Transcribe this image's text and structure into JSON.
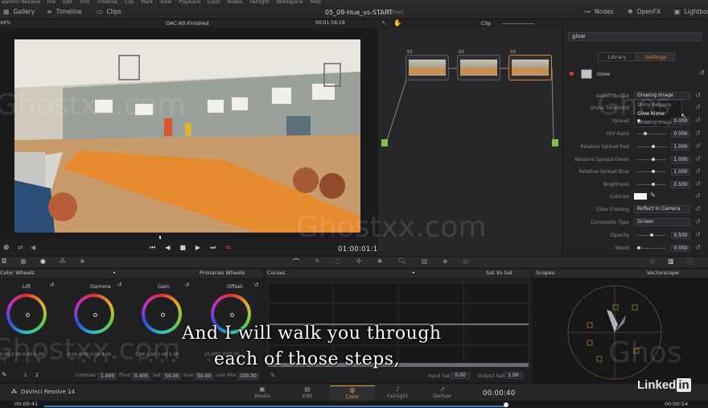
{
  "menu": [
    "DaVinci Resolve",
    "File",
    "Edit",
    "Trim",
    "Timeline",
    "Clip",
    "Mark",
    "View",
    "Playback",
    "Color",
    "Nodes",
    "Fairlight",
    "Workspace",
    "Help"
  ],
  "toolbar": {
    "gallery": "Gallery",
    "timeline": "Timeline",
    "clips": "Clips",
    "project_title": "05_09-Hue_vs-START",
    "edited": "Edited",
    "nodes": "Nodes",
    "openfx": "OpenFX",
    "lightbox": "Lightbox"
  },
  "viewer": {
    "zoom": "48%",
    "clip_name": "OAC-60-Finished",
    "timecode_top": "00:01:59:19",
    "timecode": "01:00:01:12"
  },
  "node_editor": {
    "mode": "Clip",
    "nodes": [
      "01",
      "02",
      "03"
    ]
  },
  "fx": {
    "search": "glow",
    "tab_library": "Library",
    "tab_settings": "Settings",
    "effect_name": "Glow",
    "select_output_label": "Select Output",
    "select_output_value": "Glowing Image",
    "dropdown_options": [
      "Shiny Regions",
      "Glow Alone",
      "Glowing Image"
    ],
    "shine_threshold_label": "Shine Threshold",
    "params": [
      {
        "label": "Spread",
        "value": "0.000"
      },
      {
        "label": "H/V Ratio",
        "value": "0.000"
      },
      {
        "label": "Relative Spread Red",
        "value": "1.000"
      },
      {
        "label": "Relative Spread Green",
        "value": "1.000"
      },
      {
        "label": "Relative Spread Blue",
        "value": "1.000"
      },
      {
        "label": "Brightness",
        "value": "0.500"
      }
    ],
    "colorize_label": "Colorize",
    "glow_framing_label": "Glow Framing",
    "glow_framing_value": "Reflect In Camera",
    "composite_label": "Composite Type",
    "composite_value": "Screen",
    "opacity_label": "Opacity",
    "opacity_value": "0.500",
    "blend_label": "Blend",
    "blend_value": "0.000"
  },
  "color_wheels": {
    "header": "Color Wheels",
    "mode": "Primaries Wheels",
    "wheels": [
      "Lift",
      "Gamma",
      "Gain",
      "Offset"
    ],
    "lift_vals": [
      "0.00",
      "0.00",
      "0.00",
      "0.00"
    ],
    "gamma_vals": [
      "0.00",
      "0.00",
      "0.00",
      "0.00"
    ],
    "gain_vals": [
      "1.00",
      "1.00",
      "1.00",
      "1.00"
    ],
    "offset_vals": [
      "25.00",
      "25.00",
      "25.00"
    ],
    "channel_lbls": [
      "Y",
      "R",
      "G",
      "B"
    ],
    "contrast_label": "Contrast",
    "contrast": "1.000",
    "pivot_label": "Pivot",
    "pivot": "0.435",
    "sat_label": "Sat",
    "sat": "50.00",
    "hue_label": "Hue",
    "hue": "50.00",
    "lummix_label": "Lum Mix",
    "lummix": "100.00",
    "page_1": "1",
    "page_2": "2"
  },
  "curves": {
    "header": "Curves",
    "mode": "Sat Vs Sat",
    "input_sat_label": "Input Sat",
    "input_sat": "0.00",
    "output_sat_label": "Output Sat",
    "output_sat": "1.00"
  },
  "scopes": {
    "header": "Scopes",
    "mode": "Vectorscope"
  },
  "pages": [
    "Media",
    "Edit",
    "Color",
    "Fairlight",
    "Deliver"
  ],
  "active_page": "Color",
  "app_label": "DaVinci Resolve 14",
  "bottom_timecode": "00:00:40",
  "timeline_start": "00:00:41",
  "timeline_end": "00:00:54",
  "subtitle_line1": "And I will walk you through",
  "subtitle_line2": "each of those steps,",
  "watermark": "Ghostxx.com",
  "watermark_short": "Ghos",
  "brand": "Linked",
  "brand_in": "in"
}
